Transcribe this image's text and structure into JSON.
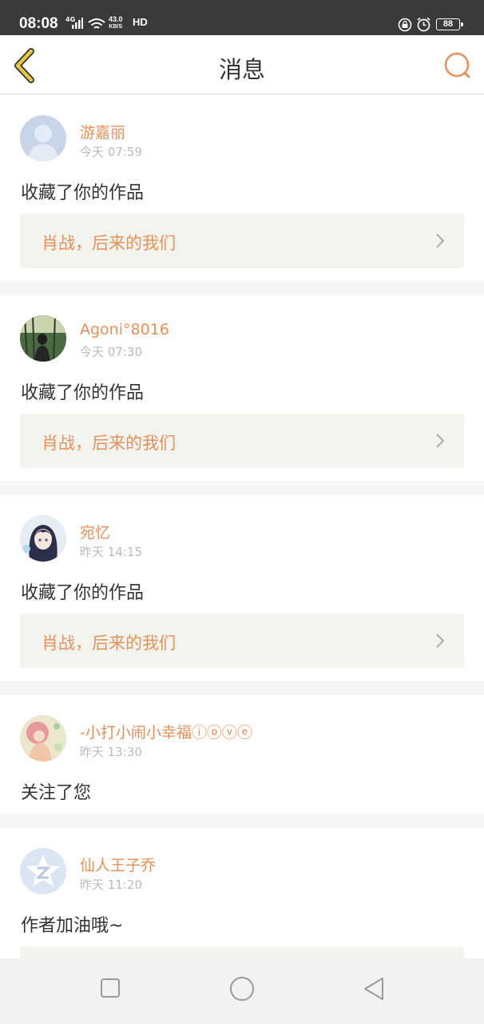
{
  "status_bar": {
    "time": "08:08",
    "network": "4G",
    "speed_value": "43.0",
    "speed_unit": "KB/S",
    "hd": "HD",
    "battery": "88"
  },
  "header": {
    "title": "消息",
    "back_icon": "chevron-left-icon",
    "search_icon": "search-icon"
  },
  "messages": [
    {
      "user": "游嘉丽",
      "time": "今天 07:59",
      "action": "收藏了你的作品",
      "work": "肖战，后来的我们",
      "avatar": "default-avatar"
    },
    {
      "user": "Agoni°8016",
      "time": "今天 07:30",
      "action": "收藏了你的作品",
      "work": "肖战，后来的我们",
      "avatar": "photo-avatar"
    },
    {
      "user": "宛忆",
      "time": "昨天 14:15",
      "action": "收藏了你的作品",
      "work": "肖战，后来的我们",
      "avatar": "anime-avatar"
    },
    {
      "user": "-小打小闹小幸福ⓘⓞⓥⓔ",
      "time": "昨天 13:30",
      "action": "关注了您",
      "work": null,
      "avatar": "illustration-avatar"
    },
    {
      "user": "仙人王子乔",
      "time": "昨天 11:20",
      "action": "作者加油哦~",
      "work": "",
      "avatar": "logo-avatar"
    }
  ],
  "colors": {
    "accent": "#e8905a",
    "back_icon": "#e8c840",
    "status_bar": "#3a3a3a",
    "work_bg": "#f4f4ee"
  },
  "nav_bar": {
    "items": [
      "square-recents-icon",
      "circle-home-icon",
      "triangle-back-icon"
    ]
  }
}
